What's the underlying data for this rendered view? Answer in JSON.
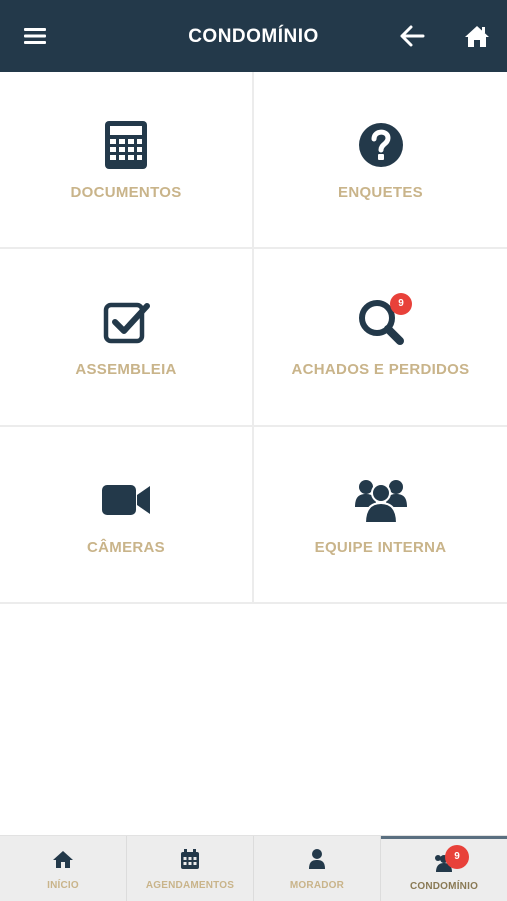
{
  "header": {
    "title": "CONDOMÍNIO",
    "menu_icon": "hamburger-icon",
    "back_icon": "arrow-left-icon",
    "home_icon": "home-icon",
    "background": "#23394a"
  },
  "tiles": [
    {
      "label": "DOCUMENTOS",
      "icon": "calculator-icon"
    },
    {
      "label": "ENQUETES",
      "icon": "question-circle-icon"
    },
    {
      "label": "ASSEMBLEIA",
      "icon": "checkbox-icon"
    },
    {
      "label": "ACHADOS E PERDIDOS",
      "icon": "search-icon",
      "badge": "9"
    },
    {
      "label": "CÂMERAS",
      "icon": "video-camera-icon"
    },
    {
      "label": "EQUIPE INTERNA",
      "icon": "users-icon"
    }
  ],
  "tabbar": {
    "items": [
      {
        "label": "INÍCIO",
        "icon": "home-icon"
      },
      {
        "label": "AGENDAMENTOS",
        "icon": "calendar-icon"
      },
      {
        "label": "MORADOR",
        "icon": "user-icon"
      },
      {
        "label": "CONDOMÍNIO",
        "icon": "users-icon",
        "badge": "9",
        "active": true
      }
    ]
  },
  "colors": {
    "icon": "#23394a",
    "label": "#c9b48a",
    "badge": "#e8413a"
  }
}
